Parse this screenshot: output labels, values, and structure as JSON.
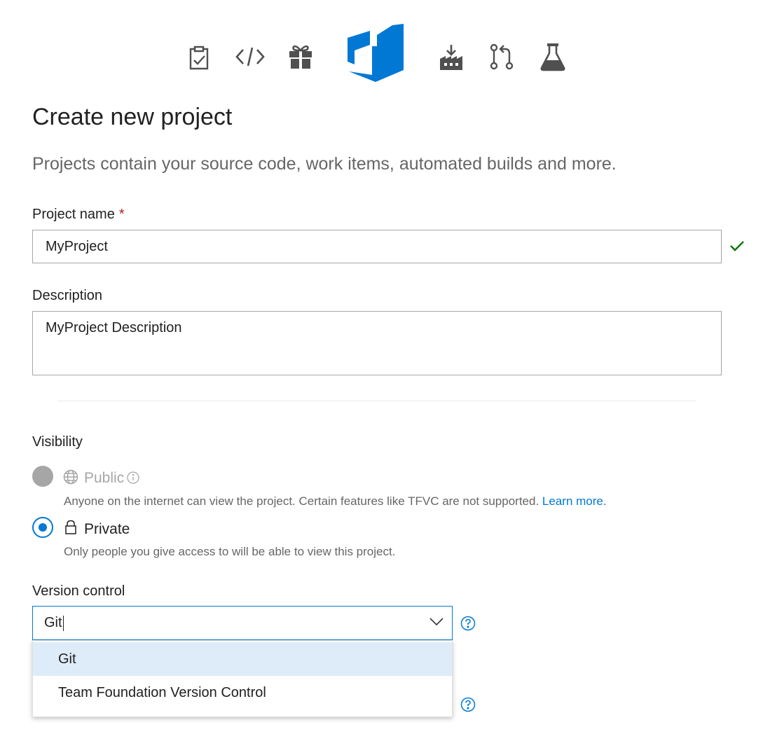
{
  "header": {
    "icons": [
      "boards-icon",
      "code-icon",
      "artifacts-icon",
      "azure-devops-logo",
      "pipelines-icon",
      "repos-icon",
      "test-plans-icon"
    ]
  },
  "page": {
    "title": "Create new project",
    "subtitle": "Projects contain your source code, work items, automated builds and more."
  },
  "form": {
    "project_name_label": "Project name",
    "required_marker": "*",
    "project_name_value": "MyProject",
    "description_label": "Description",
    "description_value": "MyProject Description",
    "visibility_label": "Visibility",
    "public_label": "Public",
    "public_desc": "Anyone on the internet can view the project. Certain features like TFVC are not supported.",
    "learn_more": "Learn more.",
    "private_label": "Private",
    "private_desc": "Only people you give access to will be able to view this project.",
    "version_control_label": "Version control",
    "version_control_value": "Git",
    "version_control_options": [
      "Git",
      "Team Foundation Version Control"
    ],
    "selected_option_index": 0
  },
  "colors": {
    "accent": "#0078d4",
    "valid_check": "#107c10",
    "required": "#a4262c",
    "icon_gray": "#505050"
  }
}
